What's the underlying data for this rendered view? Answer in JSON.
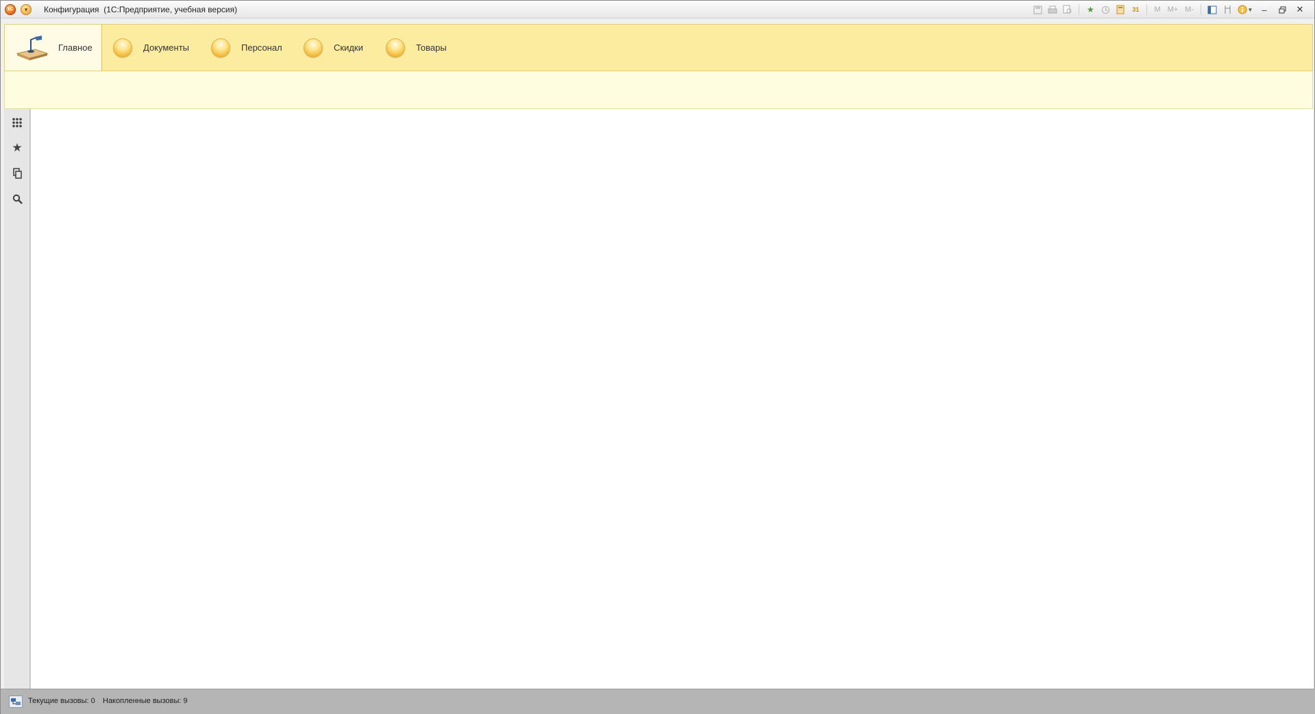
{
  "window": {
    "title": "Конфигурация  (1С:Предприятие, учебная версия)",
    "logo_text": "1С"
  },
  "toolbar": {
    "tools": [
      "save-icon",
      "print-icon",
      "preview-icon",
      "add-favorite-icon",
      "history-icon",
      "calculator-icon",
      "calendar-icon"
    ],
    "memory_labels": [
      "M",
      "M+",
      "M-"
    ],
    "calendar_label": "31",
    "window_controls": [
      "minimize",
      "restore",
      "close"
    ]
  },
  "sections": [
    {
      "label": "Главное",
      "icon": "desktop-icon",
      "active": true
    },
    {
      "label": "Документы",
      "icon": "bulb-icon",
      "active": false
    },
    {
      "label": "Персонал",
      "icon": "bulb-icon",
      "active": false
    },
    {
      "label": "Скидки",
      "icon": "bulb-icon",
      "active": false
    },
    {
      "label": "Товары",
      "icon": "bulb-icon",
      "active": false
    }
  ],
  "leftbar": {
    "items": [
      "all-functions-icon",
      "favorites-icon",
      "history-icon",
      "search-icon"
    ]
  },
  "status": {
    "current_calls": "Текущие вызовы: 0",
    "accumulated_calls": "Накопленные вызовы: 9"
  },
  "colors": {
    "section_panel": "#fcec9f",
    "active_section": "#fffbe4",
    "command_bar": "#fffde0",
    "statusbar": "#b5b5b5"
  }
}
